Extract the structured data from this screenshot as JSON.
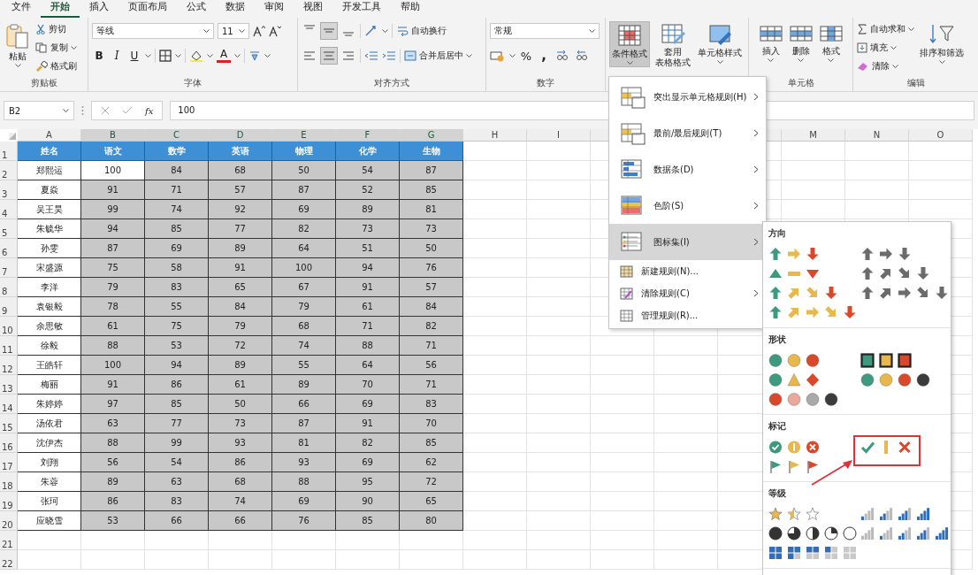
{
  "ribbon_tabs": [
    {
      "label": "文件",
      "selected": false
    },
    {
      "label": "开始",
      "selected": true
    },
    {
      "label": "插入",
      "selected": false
    },
    {
      "label": "页面布局",
      "selected": false
    },
    {
      "label": "公式",
      "selected": false
    },
    {
      "label": "数据",
      "selected": false
    },
    {
      "label": "审阅",
      "selected": false
    },
    {
      "label": "视图",
      "selected": false
    },
    {
      "label": "开发工具",
      "selected": false
    },
    {
      "label": "帮助",
      "selected": false
    }
  ],
  "clipboard": {
    "paste": "粘贴",
    "cut": "剪切",
    "copy": "复制",
    "format_painter": "格式刷",
    "group_label": "剪贴板"
  },
  "font": {
    "name": "等线",
    "size": "11",
    "bold": "B",
    "italic": "I",
    "underline": "U",
    "font_color": "A",
    "group_label": "字体"
  },
  "alignment": {
    "wrap": "自动换行",
    "merge": "合并后居中",
    "group_label": "对齐方式"
  },
  "number": {
    "format": "常规",
    "percent": "%",
    "comma": ",",
    "group_label": "数字"
  },
  "styles": {
    "conditional": {
      "label": "条件格式",
      "selected": true
    },
    "table_format": [
      "套用",
      "表格格式"
    ],
    "cell_styles": "单元格样式"
  },
  "cells": {
    "insert": "插入",
    "delete": "删除",
    "format": "格式",
    "group_label": "单元格"
  },
  "editing": {
    "autosum": "自动求和",
    "fill": "填充",
    "clear": "清除",
    "sort_filter": "排序和筛选",
    "group_label": "编辑"
  },
  "formula_bar": {
    "name_box": "B2",
    "fx": "fx",
    "value": "100"
  },
  "sheet": {
    "columns": [
      {
        "label": "A",
        "selected": false
      },
      {
        "label": "B",
        "selected": true
      },
      {
        "label": "C",
        "selected": true
      },
      {
        "label": "D",
        "selected": true
      },
      {
        "label": "E",
        "selected": true
      },
      {
        "label": "F",
        "selected": true
      },
      {
        "label": "G",
        "selected": true
      },
      {
        "label": "H",
        "selected": false
      },
      {
        "label": "I",
        "selected": false
      },
      {},
      {},
      {},
      {
        "label": "M",
        "selected": false
      },
      {
        "label": "N",
        "selected": false
      },
      {
        "label": "O",
        "selected": false
      }
    ],
    "rows": [
      {
        "number": "1",
        "kind": "header",
        "cells": [
          "姓名",
          "语文",
          "数学",
          "英语",
          "物理",
          "化学",
          "生物"
        ]
      },
      {
        "number": "2",
        "kind": "data",
        "cells": [
          "郑熙运",
          "100",
          "84",
          "68",
          "50",
          "54",
          "87"
        ]
      },
      {
        "number": "3",
        "kind": "data",
        "cells": [
          "夏焱",
          "91",
          "71",
          "57",
          "87",
          "52",
          "85"
        ]
      },
      {
        "number": "4",
        "kind": "data",
        "cells": [
          "吴王昊",
          "99",
          "74",
          "92",
          "69",
          "89",
          "81"
        ]
      },
      {
        "number": "5",
        "kind": "data",
        "cells": [
          "朱毓华",
          "94",
          "85",
          "77",
          "82",
          "73",
          "73"
        ]
      },
      {
        "number": "6",
        "kind": "data",
        "cells": [
          "孙雯",
          "87",
          "69",
          "89",
          "64",
          "51",
          "50"
        ]
      },
      {
        "number": "7",
        "kind": "data",
        "cells": [
          "宋盛源",
          "75",
          "58",
          "91",
          "100",
          "94",
          "76"
        ]
      },
      {
        "number": "8",
        "kind": "data",
        "cells": [
          "李洋",
          "79",
          "83",
          "65",
          "67",
          "91",
          "57"
        ]
      },
      {
        "number": "9",
        "kind": "data",
        "cells": [
          "袁银毅",
          "78",
          "55",
          "84",
          "79",
          "61",
          "84"
        ]
      },
      {
        "number": "10",
        "kind": "data",
        "cells": [
          "余思敏",
          "61",
          "75",
          "79",
          "68",
          "71",
          "82"
        ]
      },
      {
        "number": "11",
        "kind": "data",
        "cells": [
          "徐毅",
          "88",
          "53",
          "72",
          "74",
          "88",
          "71"
        ]
      },
      {
        "number": "12",
        "kind": "data",
        "cells": [
          "王皓轩",
          "100",
          "94",
          "89",
          "55",
          "64",
          "56"
        ]
      },
      {
        "number": "13",
        "kind": "data",
        "cells": [
          "梅丽",
          "91",
          "86",
          "61",
          "89",
          "70",
          "71"
        ]
      },
      {
        "number": "14",
        "kind": "data",
        "cells": [
          "朱婷婷",
          "97",
          "85",
          "50",
          "66",
          "69",
          "83"
        ]
      },
      {
        "number": "15",
        "kind": "data",
        "cells": [
          "汤依君",
          "63",
          "77",
          "73",
          "87",
          "91",
          "70"
        ]
      },
      {
        "number": "16",
        "kind": "data",
        "cells": [
          "沈伊杰",
          "88",
          "99",
          "93",
          "81",
          "82",
          "85"
        ]
      },
      {
        "number": "17",
        "kind": "data",
        "cells": [
          "刘翔",
          "56",
          "54",
          "86",
          "93",
          "69",
          "62"
        ]
      },
      {
        "number": "18",
        "kind": "data",
        "cells": [
          "朱蓉",
          "89",
          "63",
          "68",
          "88",
          "95",
          "72"
        ]
      },
      {
        "number": "19",
        "kind": "data",
        "cells": [
          "张珂",
          "86",
          "83",
          "74",
          "69",
          "90",
          "65"
        ]
      },
      {
        "number": "20",
        "kind": "data",
        "cells": [
          "应晓雪",
          "53",
          "66",
          "66",
          "76",
          "85",
          "80"
        ]
      },
      {
        "number": "21",
        "kind": "empty"
      },
      {
        "number": "22",
        "kind": "empty"
      }
    ]
  },
  "cf_menu": {
    "items": [
      {
        "label": "突出显示单元格规则(H)",
        "kind": "big",
        "submenu": true,
        "selected": false
      },
      {
        "label": "最前/最后规则(T)",
        "kind": "big",
        "submenu": true,
        "selected": false
      },
      {
        "label": "数据条(D)",
        "kind": "big",
        "submenu": true,
        "selected": false
      },
      {
        "label": "色阶(S)",
        "kind": "big",
        "submenu": true,
        "selected": false
      },
      {
        "label": "图标集(I)",
        "kind": "big",
        "submenu": true,
        "selected": true
      },
      {
        "label": "新建规则(N)...",
        "kind": "small",
        "submenu": false,
        "selected": false
      },
      {
        "label": "清除规则(C)",
        "kind": "small",
        "submenu": true,
        "selected": false
      },
      {
        "label": "管理规则(R)...",
        "kind": "small",
        "submenu": false,
        "selected": false
      }
    ]
  },
  "icon_sets_menu": {
    "sections": [
      {
        "title": "方向"
      },
      {
        "title": "形状"
      },
      {
        "title": "标记"
      },
      {
        "title": "等级"
      }
    ]
  }
}
